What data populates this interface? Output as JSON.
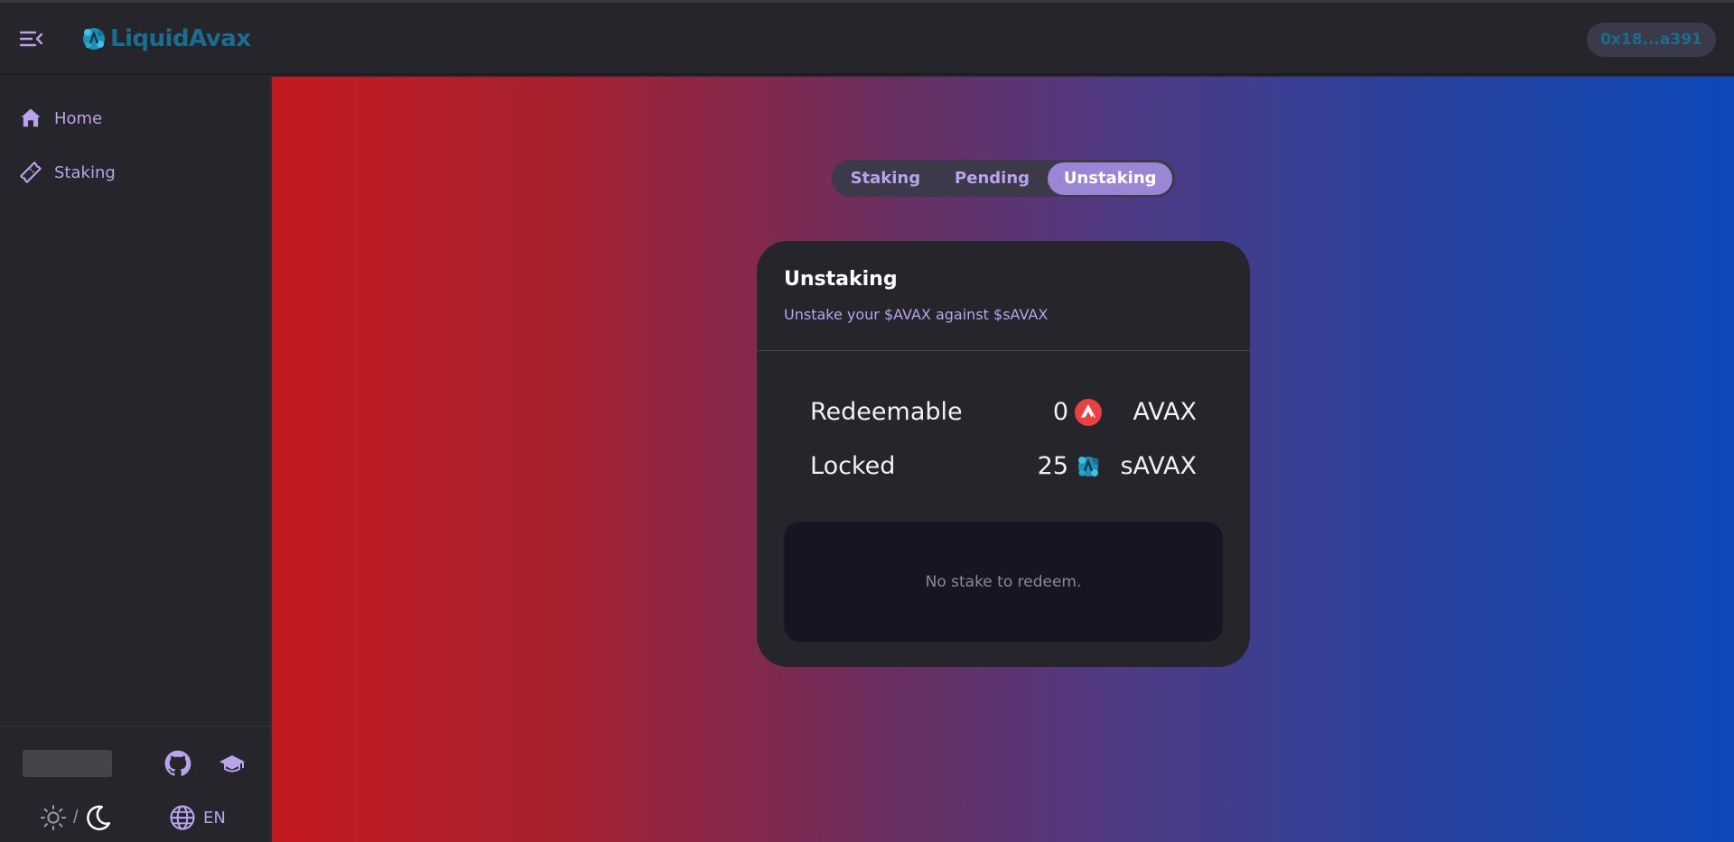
{
  "app": {
    "name": "LiquidAvax"
  },
  "header": {
    "wallet_address": "0x18...a391"
  },
  "sidebar": {
    "items": [
      {
        "label": "Home",
        "icon": "home-icon"
      },
      {
        "label": "Staking",
        "icon": "ticket-icon"
      }
    ],
    "footer": {
      "theme_separator": "/",
      "language": "EN"
    }
  },
  "tabs": [
    {
      "label": "Staking",
      "active": false
    },
    {
      "label": "Pending",
      "active": false
    },
    {
      "label": "Unstaking",
      "active": true
    }
  ],
  "card": {
    "title": "Unstaking",
    "subtitle": "Unstake your $AVAX against $sAVAX",
    "rows": [
      {
        "label": "Redeemable",
        "value": "0",
        "unit": "AVAX",
        "icon": "avax-icon"
      },
      {
        "label": "Locked",
        "value": "25",
        "unit": "sAVAX",
        "icon": "savax-icon"
      }
    ],
    "empty_message": "No stake to redeem."
  },
  "colors": {
    "accent": "#b9a3ea",
    "brand": "#1a6d8f",
    "active_tab": "#9a86d5",
    "gradient_left": "#c41a1e",
    "gradient_right": "#0d49b9"
  }
}
